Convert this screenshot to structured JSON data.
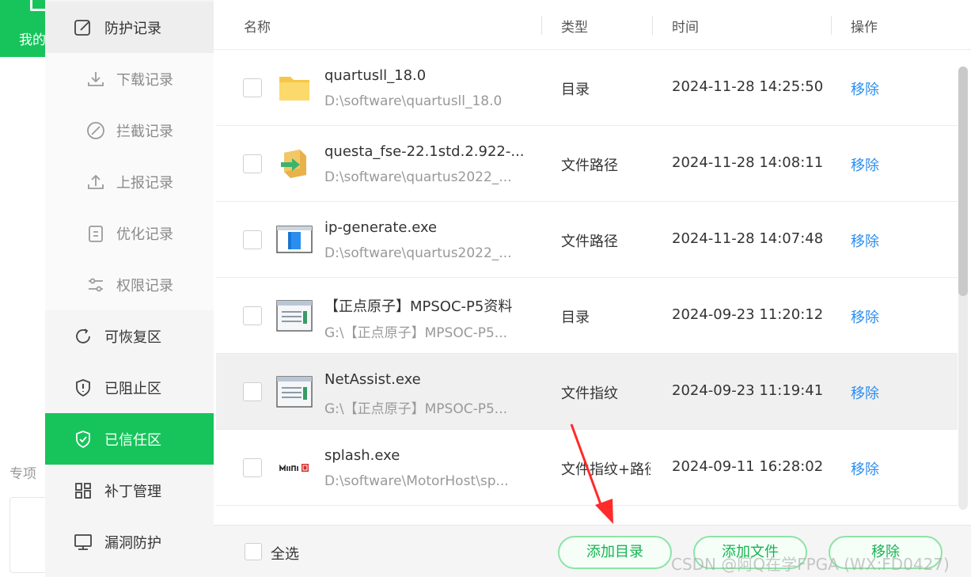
{
  "background_app": {
    "tab_label": "我的",
    "section_label": "专项"
  },
  "sidebar": {
    "header": {
      "label": "防护记录",
      "icon": "edit-icon"
    },
    "sub_items": [
      {
        "label": "下载记录",
        "icon": "download-icon"
      },
      {
        "label": "拦截记录",
        "icon": "block-icon"
      },
      {
        "label": "上报记录",
        "icon": "upload-icon"
      },
      {
        "label": "优化记录",
        "icon": "clipboard-icon"
      },
      {
        "label": "权限记录",
        "icon": "sliders-icon"
      }
    ],
    "items": [
      {
        "label": "可恢复区",
        "icon": "refresh-icon"
      },
      {
        "label": "已阻止区",
        "icon": "shield-alert-icon"
      },
      {
        "label": "已信任区",
        "icon": "shield-check-icon",
        "active": true
      },
      {
        "label": "补丁管理",
        "icon": "grid-icon"
      },
      {
        "label": "漏洞防护",
        "icon": "monitor-icon"
      }
    ],
    "accent_color": "#16c45b"
  },
  "table": {
    "columns": [
      "名称",
      "类型",
      "时间",
      "操作"
    ],
    "rows": [
      {
        "name": "quartusll_18.0",
        "path": "D:\\software\\quartusll_18.0",
        "type": "目录",
        "time": "2024-11-28 14:25:50",
        "action": "移除",
        "icon": "folder-icon"
      },
      {
        "name": "questa_fse-22.1std.2.922-...",
        "path": "D:\\software\\quartus2022_...",
        "type": "文件路径",
        "time": "2024-11-28 14:08:11",
        "action": "移除",
        "icon": "installer-icon"
      },
      {
        "name": "ip-generate.exe",
        "path": "D:\\software\\quartus2022_...",
        "type": "文件路径",
        "time": "2024-11-28 14:07:48",
        "action": "移除",
        "icon": "exe-window-icon"
      },
      {
        "name": "【正点原子】MPSOC-P5资料",
        "path": "G:\\【正点原子】MPSOC-P5...",
        "type": "目录",
        "time": "2024-09-23 11:20:12",
        "action": "移除",
        "icon": "app-window-icon"
      },
      {
        "name": "NetAssist.exe",
        "path": "G:\\【正点原子】MPSOC-P5...",
        "type": "文件指纹",
        "time": "2024-09-23 11:19:41",
        "action": "移除",
        "icon": "app-window-icon",
        "hover": true
      },
      {
        "name": "splash.exe",
        "path": "D:\\software\\MotorHost\\sp...",
        "type": "文件指纹+路径",
        "time": "2024-09-11 16:28:02",
        "action": "移除",
        "icon": "motion-logo-icon"
      }
    ],
    "link_color": "#2b8ef0"
  },
  "footer": {
    "select_all": "全选",
    "buttons": {
      "add_dir": "添加目录",
      "add_file": "添加文件",
      "remove": "移除"
    }
  },
  "watermark": "CSDN @阿Q在学FPGA (WX:FD0427)",
  "annotation": {
    "icon": "red-arrow-icon",
    "color": "#ff2a2a"
  }
}
